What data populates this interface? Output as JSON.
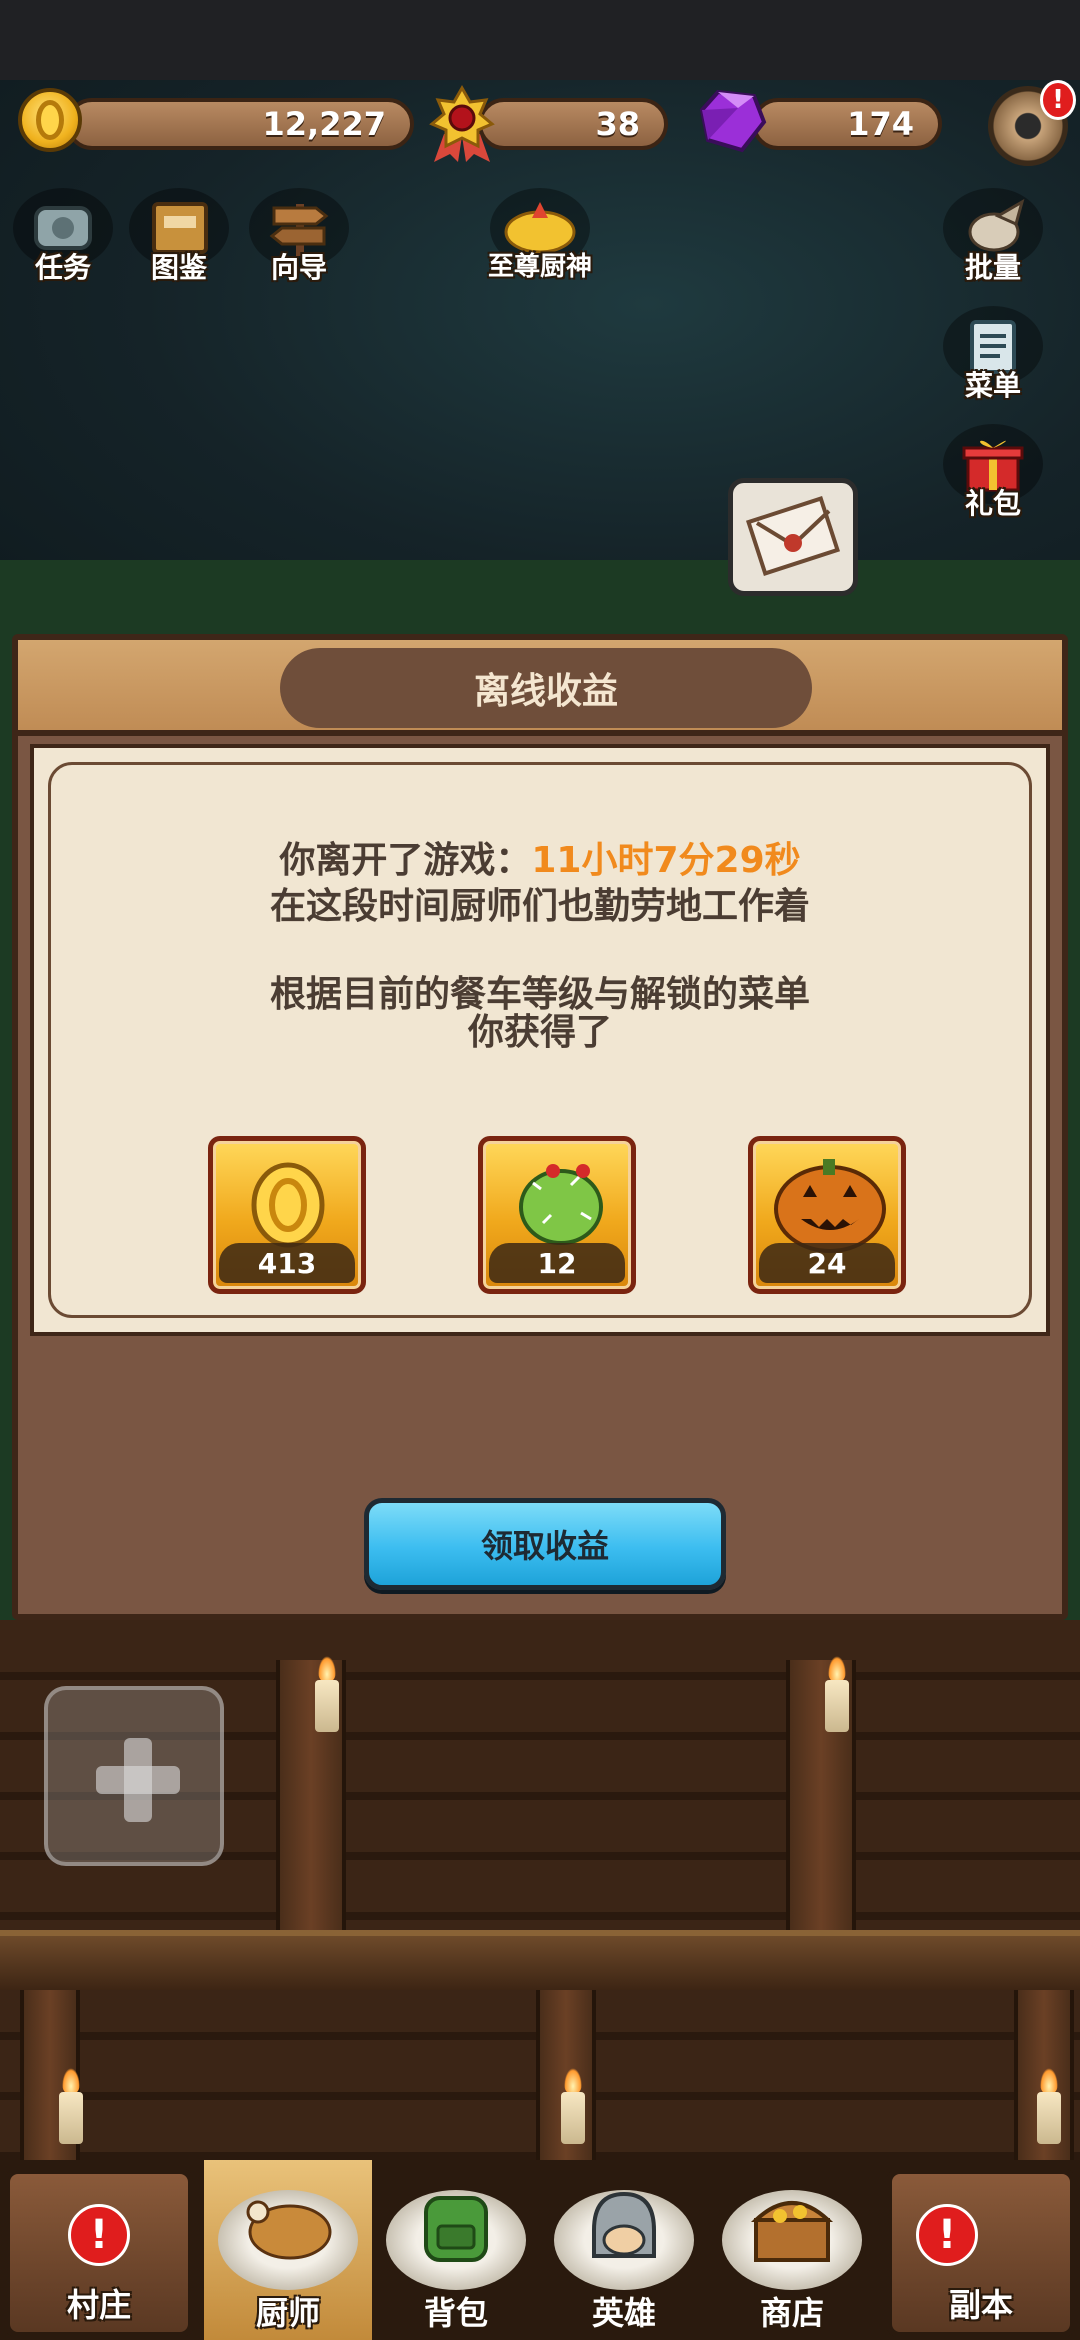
{
  "currency": {
    "coins": "12,227",
    "medals": "38",
    "gems": "174",
    "settings_alert": "!"
  },
  "top_menu": {
    "tasks": "任务",
    "catalog": "图鉴",
    "guide": "向导",
    "supreme_chef": "至尊厨神",
    "bulk": "批量",
    "menu": "菜单",
    "gift": "礼包"
  },
  "dialog": {
    "title": "离线收益",
    "away_prefix": "你离开了游戏：",
    "away_time": "11小时7分29秒",
    "line2": "在这段时间厨师们也勤劳地工作着",
    "line3": "根据目前的餐车等级与解锁的菜单",
    "line4": "你获得了",
    "rewards": [
      {
        "icon": "coin-icon",
        "count": "413"
      },
      {
        "icon": "cactus-fruit-icon",
        "count": "12"
      },
      {
        "icon": "pumpkin-icon",
        "count": "24"
      }
    ],
    "claim_label": "领取收益"
  },
  "bottom_nav": {
    "village": "村庄",
    "chef": "厨师",
    "backpack": "背包",
    "heroes": "英雄",
    "shop": "商店",
    "dungeon": "副本"
  },
  "colors": {
    "dialog_bg": "#7a5643",
    "panel_bg": "#f1e6d2",
    "highlight": "#f18a1d",
    "claim_button": "#3cbdf0"
  }
}
